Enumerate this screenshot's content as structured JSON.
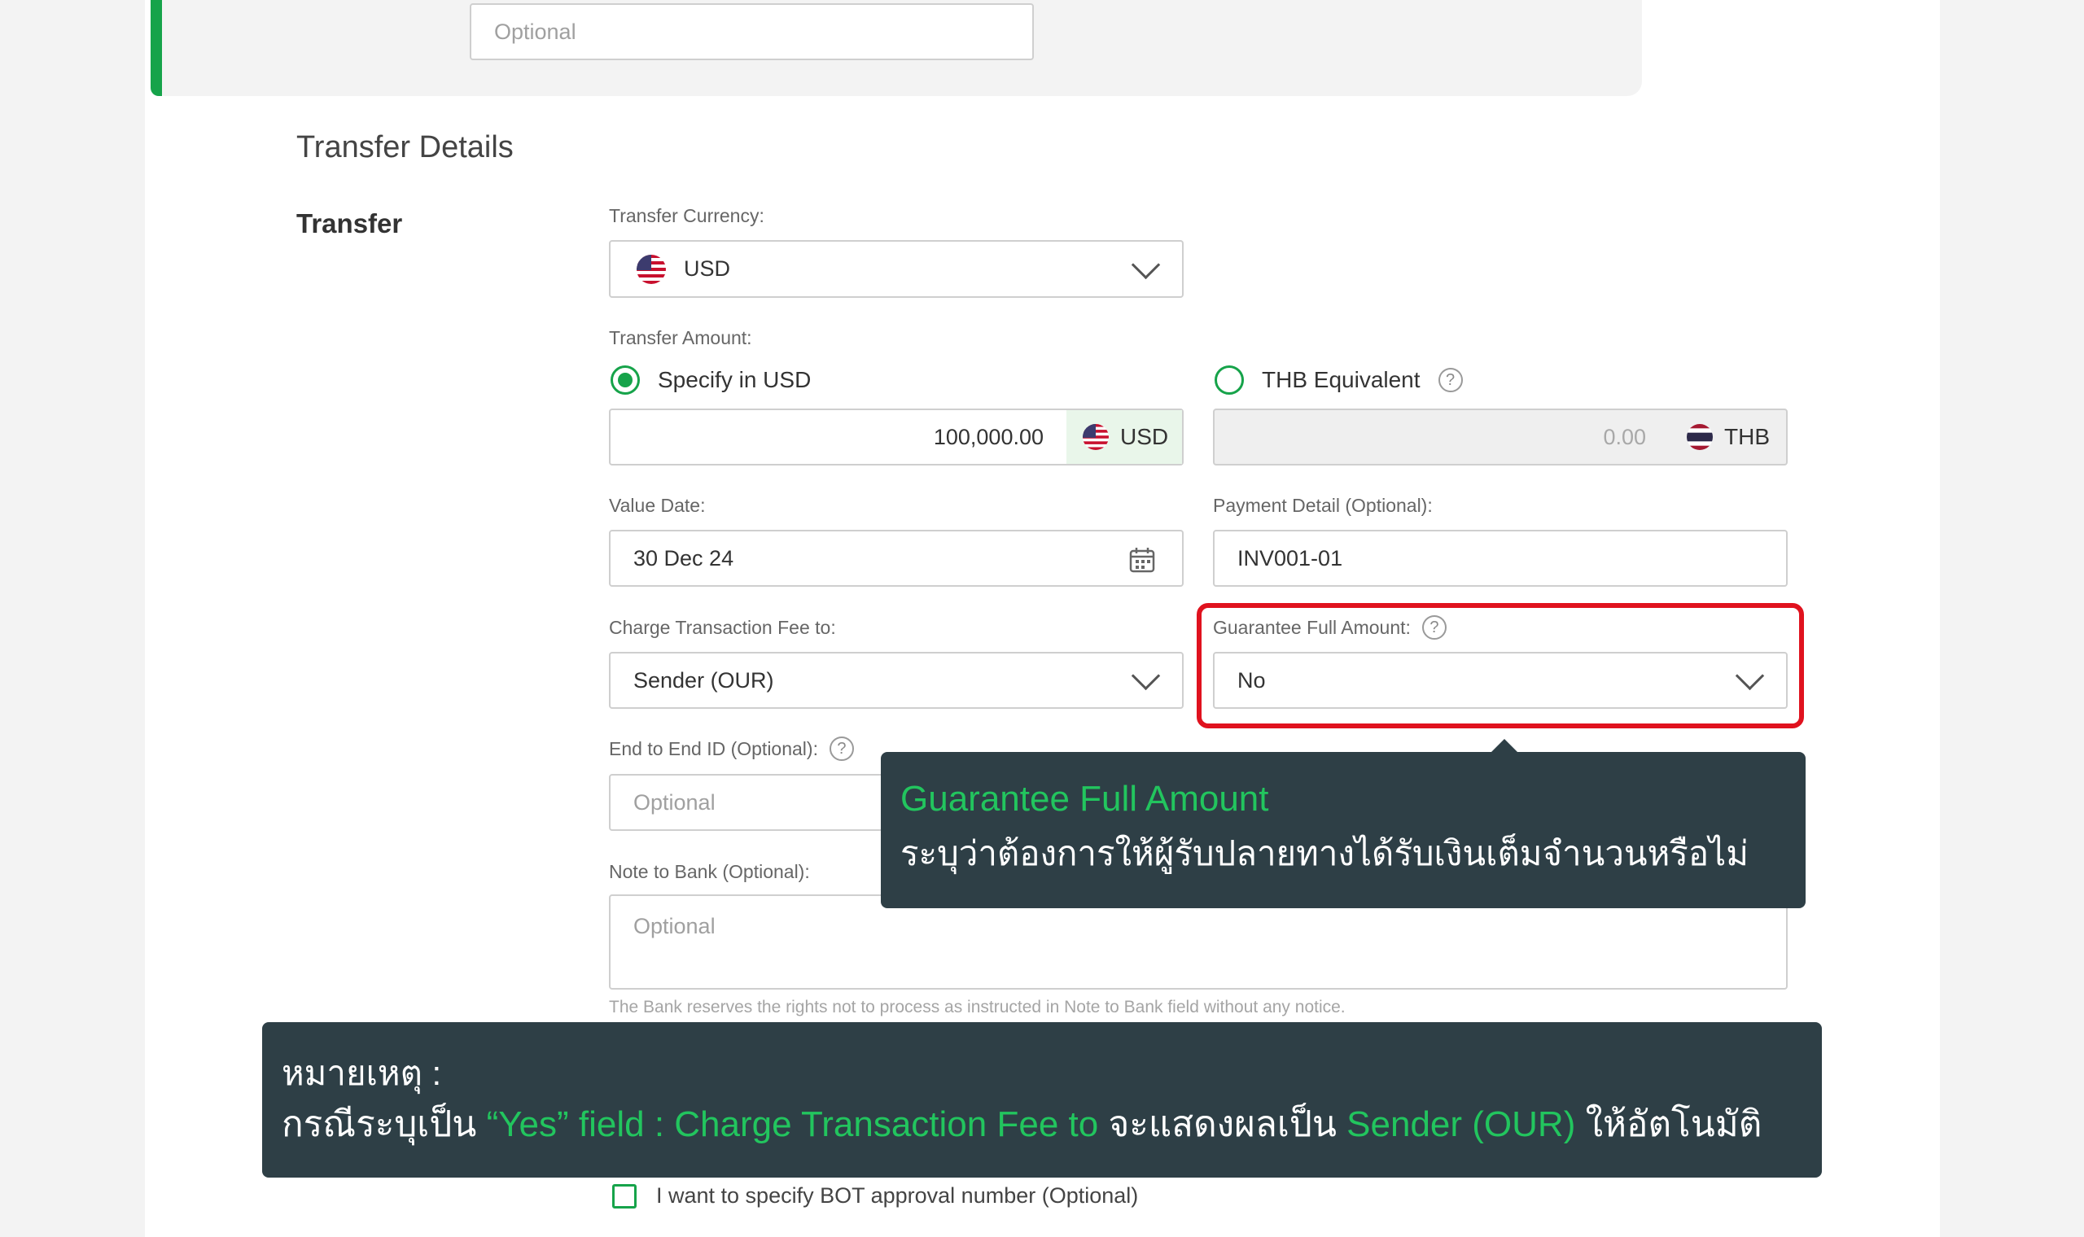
{
  "top_field": {
    "placeholder": "Optional"
  },
  "section_title": "Transfer Details",
  "subsection_title": "Transfer",
  "transfer_currency": {
    "label": "Transfer Currency:",
    "value": "USD",
    "flag": "us-flag-icon"
  },
  "transfer_amount": {
    "label": "Transfer Amount:",
    "option_usd": "Specify in USD",
    "option_thb": "THB Equivalent",
    "selected": "usd",
    "usd_value": "100,000.00",
    "usd_currency": "USD",
    "thb_value": "0.00",
    "thb_currency": "THB"
  },
  "value_date": {
    "label": "Value Date:",
    "value": "30 Dec 24"
  },
  "payment_detail": {
    "label": "Payment Detail (Optional):",
    "value": "INV001-01"
  },
  "charge_fee": {
    "label": "Charge Transaction Fee to:",
    "value": "Sender (OUR)"
  },
  "guarantee": {
    "label": "Guarantee Full Amount:",
    "value": "No"
  },
  "end_to_end": {
    "label": "End to End ID (Optional):",
    "placeholder": "Optional"
  },
  "note_to_bank": {
    "label": "Note to Bank (Optional):",
    "placeholder": "Optional",
    "disclaimer": "The Bank reserves the rights not to process as instructed in Note to Bank field without any notice."
  },
  "tooltip": {
    "title": "Guarantee Full Amount",
    "body": "ระบุว่าต้องการให้ผู้รับปลายทางได้รับเงินเต็มจำนวนหรือไม่"
  },
  "note_banner": {
    "heading": "หมายเหตุ :",
    "part1": "กรณีระบุเป็น ",
    "part2": "“Yes” field : Charge Transaction Fee to",
    "part3": " จะแสดงผลเป็น ",
    "part4": "Sender (OUR)",
    "part5": " ให้อัตโนมัติ"
  },
  "bot_checkbox": {
    "label": "I want to specify BOT approval number (Optional)",
    "checked": false
  },
  "colors": {
    "accent": "#16a34a",
    "highlight": "#e0121e",
    "dark_panel": "#2e3f46"
  }
}
